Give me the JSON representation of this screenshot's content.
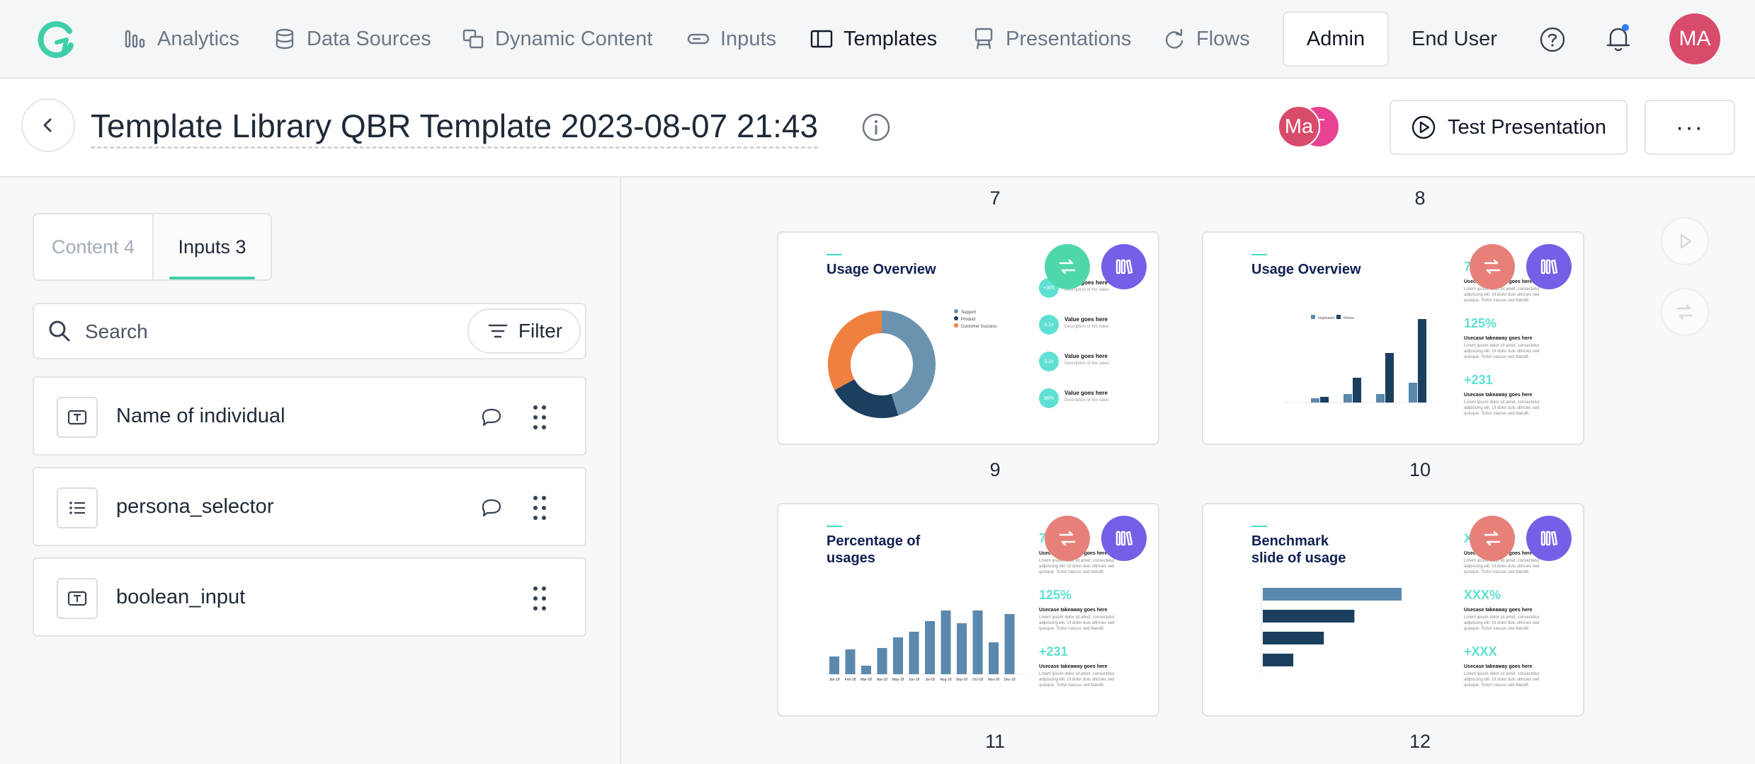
{
  "nav": {
    "items": [
      {
        "label": "Analytics",
        "icon": "analytics-icon"
      },
      {
        "label": "Data Sources",
        "icon": "database-icon"
      },
      {
        "label": "Dynamic Content",
        "icon": "dynamic-content-icon"
      },
      {
        "label": "Inputs",
        "icon": "inputs-icon"
      },
      {
        "label": "Templates",
        "icon": "templates-icon",
        "active": true
      },
      {
        "label": "Presentations",
        "icon": "presentations-icon"
      },
      {
        "label": "Flows",
        "icon": "flows-icon"
      }
    ],
    "admin_label": "Admin",
    "end_user_label": "End User",
    "user_initials": "MA",
    "accent": "#3fcfa8",
    "notification_color": "#2f7df6"
  },
  "header": {
    "title": "Template Library QBR Template 2023-08-07 21:43",
    "collaborators": [
      {
        "initials": "Ma",
        "color": "#d94b6b"
      },
      {
        "initials": "T",
        "color": "#e84393"
      }
    ],
    "test_label": "Test Presentation",
    "more_label": "···"
  },
  "left": {
    "tabs": [
      {
        "label": "Content 4",
        "active": false
      },
      {
        "label": "Inputs 3",
        "active": true
      }
    ],
    "search_placeholder": "Search",
    "filter_label": "Filter",
    "inputs": [
      {
        "label": "Name of individual",
        "type": "text",
        "has_comment": true
      },
      {
        "label": "persona_selector",
        "type": "list",
        "has_comment": true
      },
      {
        "label": "boolean_input",
        "type": "text",
        "has_comment": false
      }
    ]
  },
  "slides": {
    "numbers": [
      "7",
      "8",
      "9",
      "10",
      "11",
      "12"
    ],
    "s9": {
      "title": "Usage Overview",
      "legend": [
        "Support",
        "Product",
        "Customer Success"
      ],
      "legend_colors": [
        "#6a93b0",
        "#1b3f5e",
        "#f08040"
      ],
      "donut": [
        0.45,
        0.22,
        0.33
      ],
      "values": [
        {
          "badge": "+345",
          "title": "Value goes here",
          "desc": "Description of the value"
        },
        {
          "badge": "3.2x",
          "title": "Value goes here",
          "desc": "Description of the value"
        },
        {
          "badge": "3.2x",
          "title": "Value goes here",
          "desc": "Description of the value"
        },
        {
          "badge": "98%",
          "title": "Value goes here",
          "desc": "Description of the value"
        }
      ]
    },
    "s10": {
      "title": "Usage Overview",
      "legend": [
        "Implement",
        "Return"
      ],
      "stats": [
        {
          "big": "7",
          "head": "Usecase takeaway goes here"
        },
        {
          "big": "125%",
          "head": "Usecase takeaway goes here"
        },
        {
          "big": "+231",
          "head": "Usecase takeaway goes here"
        }
      ],
      "body": "Lorem ipsum dolor sit amet, consectetur adipiscing elit. Ut dolor duis ultricies sed quisque. Tortor nascus sed blandit."
    },
    "s11": {
      "title": "Percentage of usages",
      "stats": [
        {
          "big": "7",
          "head": "Usecase takeaway goes here"
        },
        {
          "big": "125%",
          "head": "Usecase takeaway goes here"
        },
        {
          "big": "+231",
          "head": "Usecase takeaway goes here"
        }
      ],
      "bars": [
        25,
        35,
        12,
        37,
        52,
        60,
        75,
        90,
        72,
        90,
        45,
        85
      ],
      "months": [
        "Jan-18",
        "Feb-18",
        "Mar-18",
        "Apr-18",
        "May-18",
        "Jun-18",
        "Jul-18",
        "Aug-18",
        "Sep-18",
        "Oct-18",
        "Nov-18",
        "Dec-18"
      ]
    },
    "s12": {
      "title": "Benchmark slide of usage",
      "stats": [
        {
          "big": "X",
          "head": "Usecase takeaway goes here"
        },
        {
          "big": "XXX%",
          "head": "Usecase takeaway goes here"
        },
        {
          "big": "+XXX",
          "head": "Usecase takeaway goes here"
        }
      ],
      "bars": [
        1.0,
        0.66,
        0.44,
        0.22
      ]
    }
  }
}
